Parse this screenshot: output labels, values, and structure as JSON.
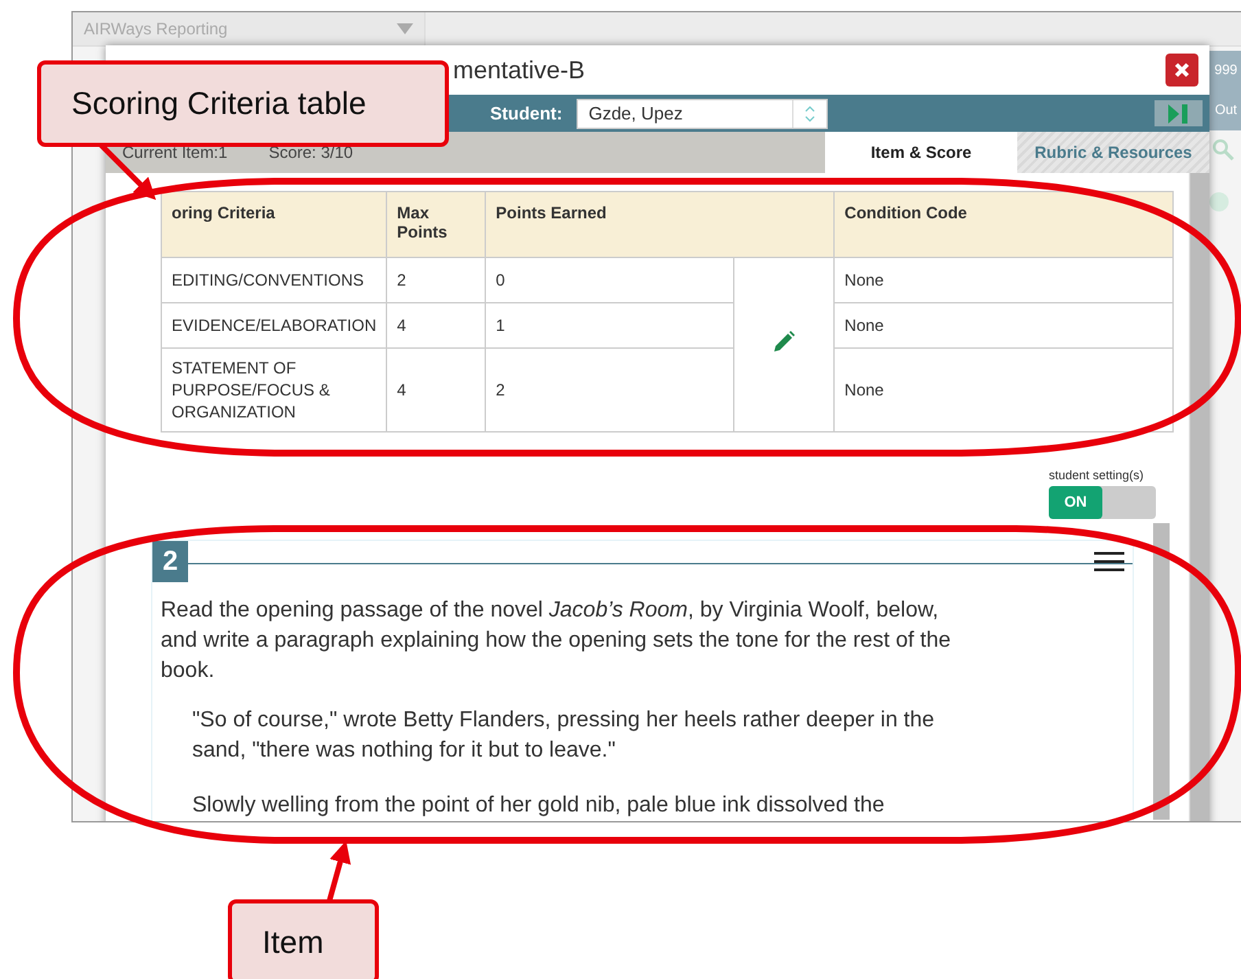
{
  "app": {
    "title": "AIRWays Reporting",
    "edge_texts": [
      "999",
      "Out"
    ]
  },
  "modal": {
    "title": "mentative-B",
    "student_label": "Student:",
    "student": "Gzde, Upez",
    "current_item": "Current Item:1",
    "score": "Score: 3/10",
    "tabs": [
      {
        "label": "Item & Score",
        "selected": true
      },
      {
        "label": "Rubric & Resources",
        "selected": false
      }
    ],
    "table": {
      "columns": [
        "oring Criteria",
        "Max Points",
        "Points Earned",
        "Condition Code"
      ],
      "rows": [
        {
          "criterion": "EDITING/CONVENTIONS",
          "max_points": "2",
          "points_earned": "0",
          "condition_code": "None"
        },
        {
          "criterion": "EVIDENCE/ELABORATION",
          "max_points": "4",
          "points_earned": "1",
          "condition_code": "None"
        },
        {
          "criterion": "STATEMENT OF PURPOSE/FOCUS & ORGANIZATION",
          "max_points": "4",
          "points_earned": "2",
          "condition_code": "None"
        }
      ]
    },
    "student_settings": {
      "label": "student setting(s)",
      "toggle_text": "ON",
      "on": true
    },
    "item": {
      "number": "2",
      "paragraphs": [
        {
          "kind": "prompt",
          "text": "Read the opening passage of the novel *Jacob’s Room*, by Virginia Woolf, below, and write a paragraph explaining how the opening sets the tone for the rest of the book."
        },
        {
          "kind": "quote",
          "text": "\"So of course,\" wrote Betty Flanders, pressing her heels rather deeper in the sand, \"there was nothing for it but to leave.\""
        },
        {
          "kind": "quote",
          "text": "Slowly welling from the point of her gold nib, pale blue ink dissolved the"
        }
      ]
    }
  },
  "callouts": [
    {
      "label": "Scoring Criteria table"
    },
    {
      "label": "Item"
    }
  ]
}
